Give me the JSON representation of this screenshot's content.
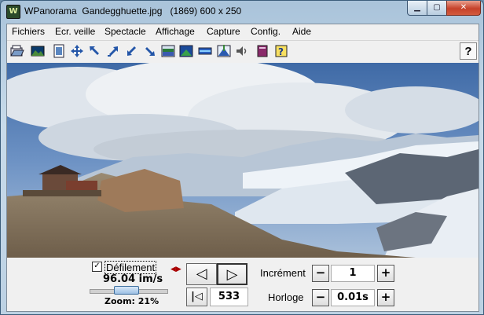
{
  "window": {
    "title": "WPanorama  Gandegghuette.jpg   (1869) 600 x 250",
    "app_icon_letter": "W"
  },
  "menubar": {
    "items": [
      "Fichiers",
      "Ecr. veille",
      "Spectacle",
      "Affichage",
      "Capture",
      "Config.",
      "Aide"
    ]
  },
  "toolbar": {
    "icons": [
      "open-icon",
      "picture-icon",
      "fit-page-icon",
      "move-icon",
      "arrow-up-left-icon",
      "arrow-up-right-icon",
      "arrow-down-left-icon",
      "arrow-down-right-icon",
      "display-mode-1-icon",
      "display-mode-2-icon",
      "display-mode-3-icon",
      "sky-marker-icon",
      "sound-icon",
      "book-icon",
      "help-doc-icon"
    ],
    "help_label": "?"
  },
  "controls": {
    "scroll_checkbox_checked": true,
    "scroll_check_mark": "✓",
    "scroll_label": "Défilement",
    "speed": "96.04 im/s",
    "zoom": "Zoom: 21%",
    "zoom_level": 0.21,
    "prev_label": "◁",
    "next_label": "▷",
    "first_label": "|◁",
    "frame_number": "533",
    "increment_label": "Incrément",
    "increment_value": "1",
    "clock_label": "Horloge",
    "clock_value": "0.01s",
    "minus": "−",
    "plus": "+"
  },
  "colors": {
    "sky_top": "#5b82b4",
    "cloud": "#e8ecf0",
    "glacier": "#dfe7ef",
    "rock": "#8a7560",
    "close_button": "#c6412a"
  }
}
